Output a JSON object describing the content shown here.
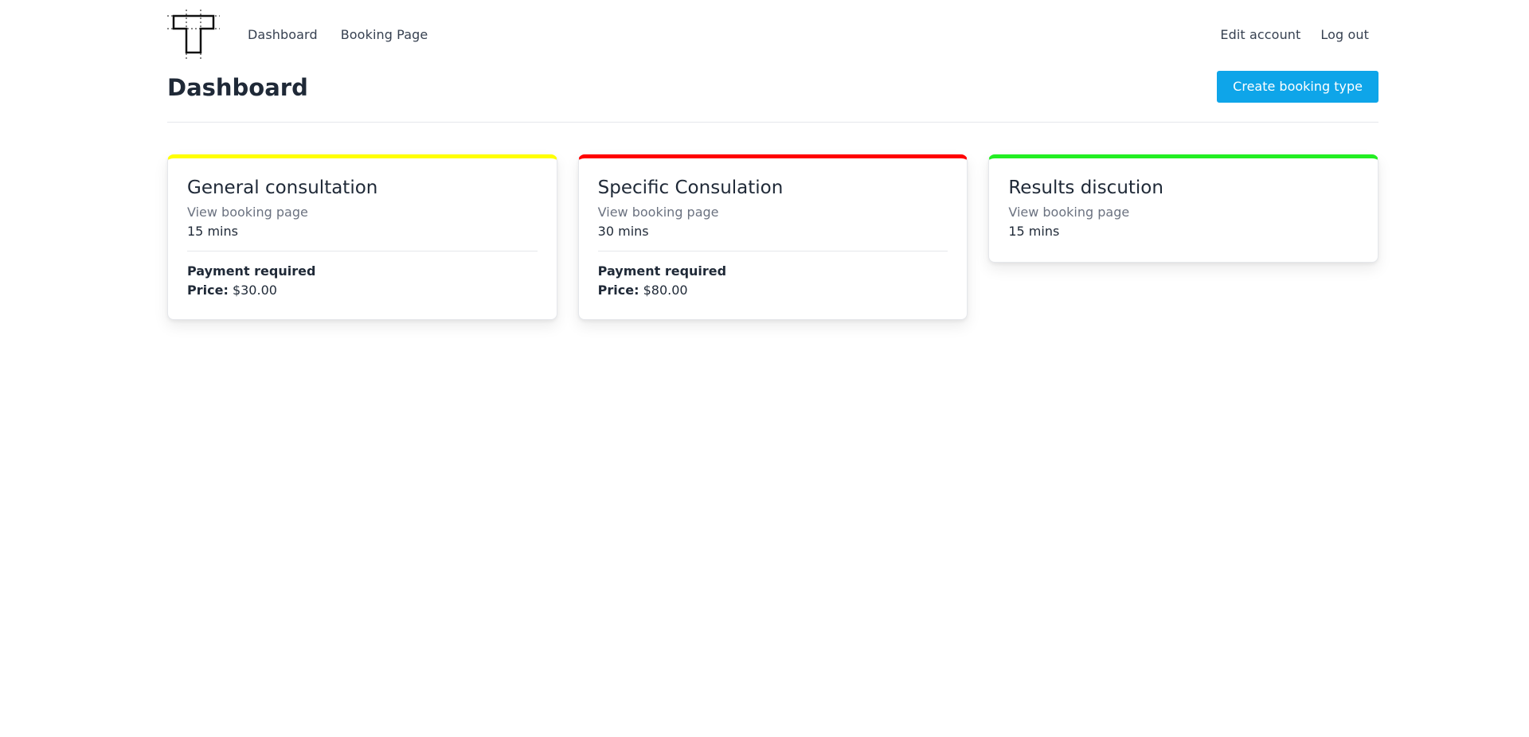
{
  "nav": {
    "left_links": [
      "Dashboard",
      "Booking Page"
    ],
    "right_links": [
      "Edit account",
      "Log out"
    ]
  },
  "header": {
    "title": "Dashboard",
    "create_button": "Create booking type"
  },
  "cards": [
    {
      "title": "General consultation",
      "link": "View booking page",
      "duration": "15 mins",
      "payment": "Payment required",
      "price_label": "Price:",
      "price_value": "$30.00",
      "accent": "#ffff00"
    },
    {
      "title": "Specific Consulation",
      "link": "View booking page",
      "duration": "30 mins",
      "payment": "Payment required",
      "price_label": "Price:",
      "price_value": "$80.00",
      "accent": "#ff0000"
    },
    {
      "title": "Results discution",
      "link": "View booking page",
      "duration": "15 mins",
      "accent": "#22ee22"
    }
  ],
  "colors": {
    "primary_button": "#0ea5e9"
  }
}
